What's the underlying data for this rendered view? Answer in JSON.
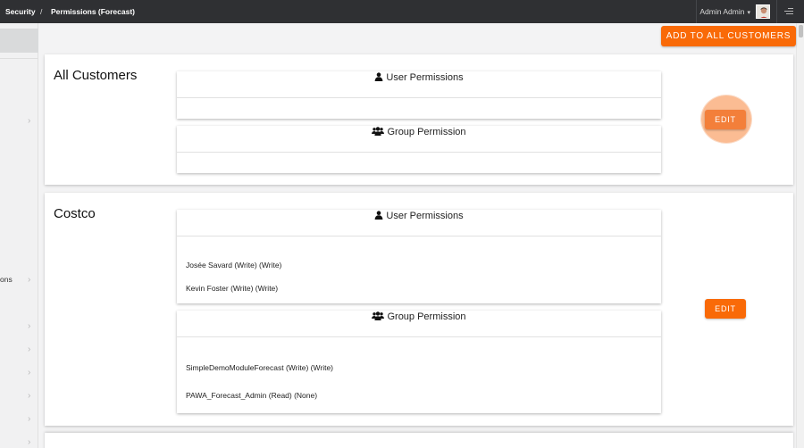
{
  "topbar": {
    "breadcrumb": [
      "Security",
      "/",
      "Permissions (Forecast)"
    ],
    "user_name": "Admin Admin",
    "caret": "▾"
  },
  "sidebar": {
    "chevron": "›",
    "label_fragment": "ons"
  },
  "actions": {
    "add_all_label": "ADD TO ALL CUSTOMERS"
  },
  "customers": [
    {
      "name": "All Customers",
      "user_permissions": {
        "heading": "User Permissions",
        "items": []
      },
      "group_permissions": {
        "heading": "Group Permission",
        "items": []
      },
      "edit_label": "EDIT"
    },
    {
      "name": "Costco",
      "user_permissions": {
        "heading": "User Permissions",
        "items": [
          "Josée Savard (Write) (Write)",
          "Kevin Foster (Write) (Write)"
        ]
      },
      "group_permissions": {
        "heading": "Group Permission",
        "items": [
          "SimpleDemoModuleForecast (Write) (Write)",
          "PAWA_Forecast_Admin (Read) (None)"
        ]
      },
      "edit_label": "EDIT"
    }
  ],
  "colors": {
    "accent": "#f96a08",
    "topbar": "#2f3033"
  }
}
